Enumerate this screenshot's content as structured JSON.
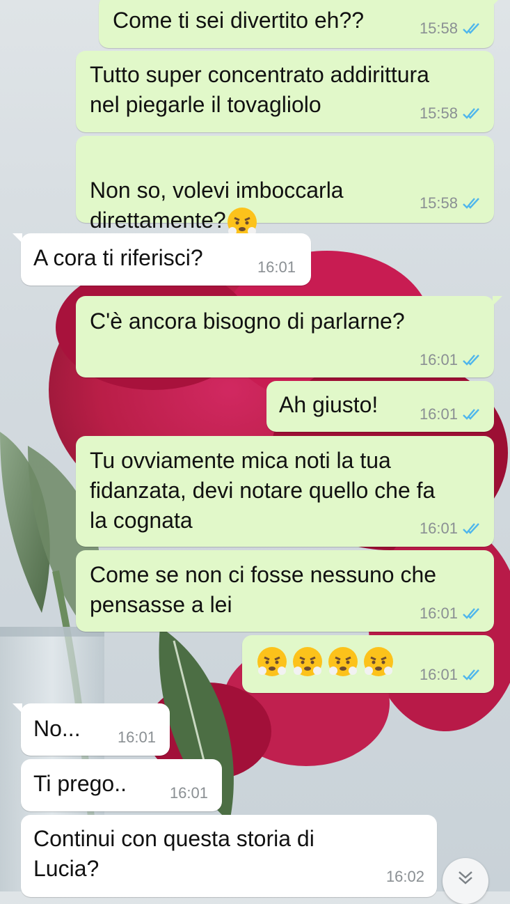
{
  "messages": [
    {
      "dir": "out",
      "text": "Come ti sei divertito eh??",
      "time": "15:58",
      "read": true
    },
    {
      "dir": "out",
      "text": "Tutto super concentrato addirittura\nnel piegarle il tovagliolo",
      "time": "15:58",
      "read": true
    },
    {
      "dir": "out",
      "text": "Non so, volevi imboccarla\ndirettamente?",
      "time": "15:58",
      "read": true,
      "emoji": [
        "face-with-steam-from-nose"
      ]
    },
    {
      "dir": "in",
      "text": "A cora ti riferisci?",
      "time": "16:01"
    },
    {
      "dir": "out",
      "text": "C'è ancora bisogno di parlarne?",
      "time": "16:01",
      "read": true
    },
    {
      "dir": "out",
      "text": "Ah giusto!",
      "time": "16:01",
      "read": true
    },
    {
      "dir": "out",
      "text": "Tu ovviamente mica noti la tua\nfidanzata, devi notare quello che fa\nla cognata",
      "time": "16:01",
      "read": true
    },
    {
      "dir": "out",
      "text": "Come se non ci fosse nessuno che\npensasse a lei",
      "time": "16:01",
      "read": true
    },
    {
      "dir": "out",
      "text": "",
      "time": "16:01",
      "read": true,
      "emoji": [
        "face-with-steam-from-nose",
        "face-with-steam-from-nose",
        "face-with-steam-from-nose",
        "face-with-steam-from-nose"
      ]
    },
    {
      "dir": "in",
      "text": "No...",
      "time": "16:01"
    },
    {
      "dir": "in",
      "text": "Ti prego..",
      "time": "16:01"
    },
    {
      "dir": "in",
      "text": "Continui con questa storia di\nLucia?",
      "time": "16:02"
    }
  ],
  "colors": {
    "outgoing_bubble": "#e1f8c9",
    "incoming_bubble": "#ffffff",
    "read_ticks": "#4fb6ec",
    "time_text": "#8a8f93"
  },
  "icons": {
    "read_receipt": "double-check-icon",
    "scroll_down": "chevron-double-down-icon"
  }
}
